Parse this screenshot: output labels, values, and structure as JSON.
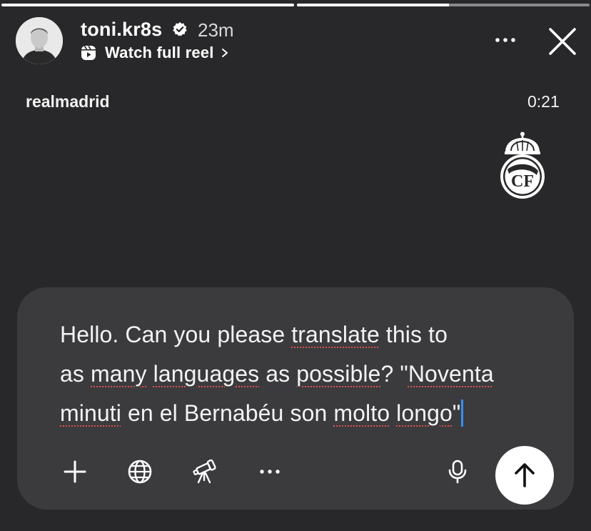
{
  "story": {
    "progress": [
      1.0,
      0.52
    ],
    "username": "toni.kr8s",
    "time_ago": "23m",
    "watch_label": "Watch full reel",
    "reel_account": "realmadrid",
    "duration": "0:21"
  },
  "composer": {
    "lines": [
      "Hello. Can you please translate this to",
      "as many languages as possible? \"Noventa",
      "minuti en el Bernabéu son molto longo\""
    ]
  },
  "icons": {
    "avatar": "avatar-photo",
    "verified": "verified-badge-icon",
    "reel": "reel-icon",
    "more": "more-icon",
    "close": "close-icon",
    "crest": "real-madrid-crest-icon",
    "plus": "plus-icon",
    "globe": "globe-icon",
    "telescope": "telescope-icon",
    "ellipsis": "ellipsis-icon",
    "mic": "microphone-icon",
    "send": "arrow-up-icon"
  },
  "colors": {
    "background": "#28282a",
    "composer": "#3b3b3e",
    "caret": "#3b8df2",
    "spellcheck": "#d9534f"
  }
}
